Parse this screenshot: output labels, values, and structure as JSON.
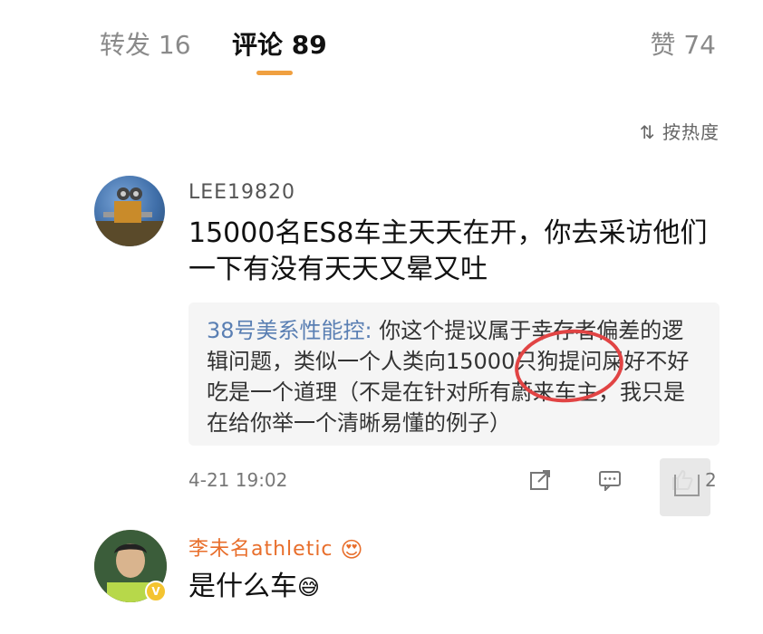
{
  "tabs": [
    {
      "label": "转发 16"
    },
    {
      "label": "评论 89"
    },
    {
      "label": "赞 74"
    }
  ],
  "sort_label": "按热度",
  "comments": [
    {
      "username": "LEE19820",
      "text": "15000名ES8车主天天在开，你去采访他们一下有没有天天又晕又吐",
      "quote": {
        "name": "38号美系性能控:",
        "text": " 你这个提议属于幸存者偏差的逻辑问题，类似一个人类向15000只狗提问屎好不好吃是一个道理（不是在针对所有蔚来车主，我只是在给你举一个清晰易懂的例子）"
      },
      "time": "4-21 19:02",
      "like_count": "2"
    },
    {
      "username": "李未名athletic",
      "text": "是什么车"
    }
  ],
  "icons": {
    "share": "share-icon",
    "reply": "comment-icon",
    "like": "thumbs-up-icon"
  },
  "colors": {
    "accent": "#f0a040",
    "username_vip": "#e86e2b",
    "quote_name": "#5a7fb3",
    "highlight_circle": "#e14444"
  }
}
